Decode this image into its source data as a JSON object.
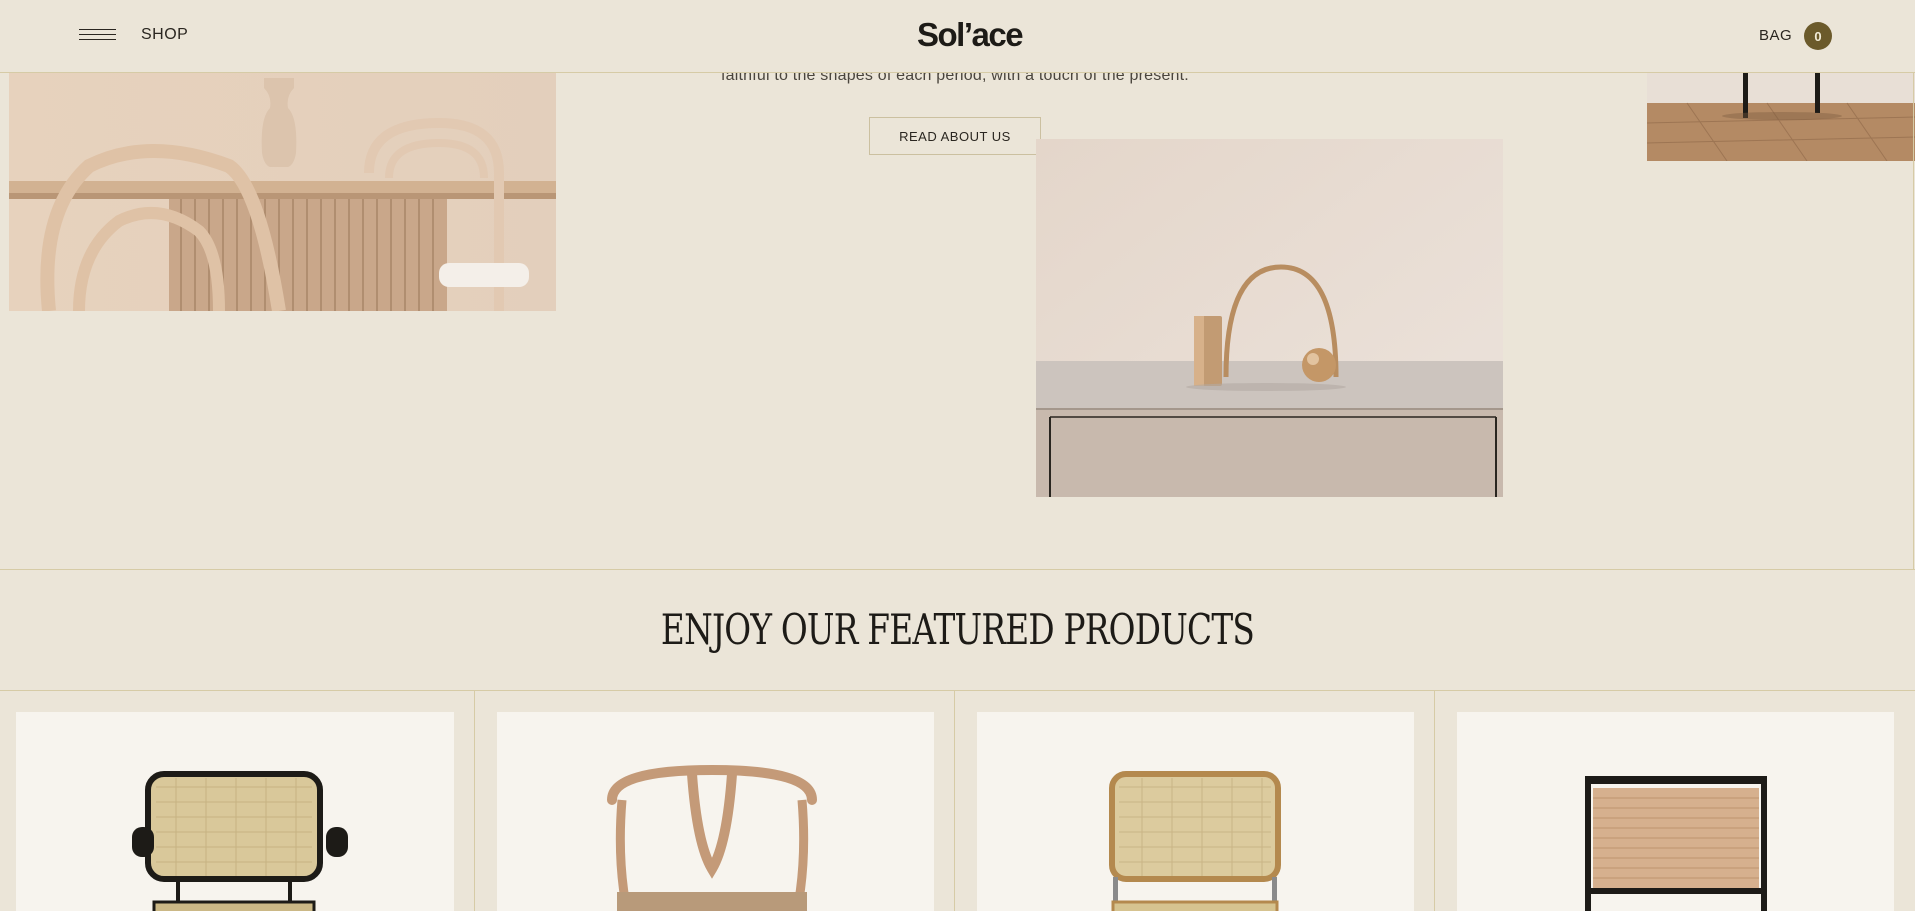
{
  "header": {
    "menu_icon": "hamburger-menu-icon",
    "shop_label": "SHOP",
    "logo": "Sol’ace",
    "bag_label": "BAG",
    "bag_count": "0"
  },
  "about": {
    "text": "faithful to the shapes of each period, with a touch of the present.",
    "read_button": "READ ABOUT US"
  },
  "featured": {
    "title": "ENJOY OUR FEATURED PRODUCTS",
    "products": [
      {
        "name": "cane-armchair-black"
      },
      {
        "name": "wishbone-chair"
      },
      {
        "name": "cane-chair-natural"
      },
      {
        "name": "cane-chair-black-frame"
      }
    ]
  },
  "colors": {
    "background": "#ebe5d8",
    "accent": "#6b5a2b",
    "border": "#d6cba6",
    "card": "#f7f4ee"
  }
}
